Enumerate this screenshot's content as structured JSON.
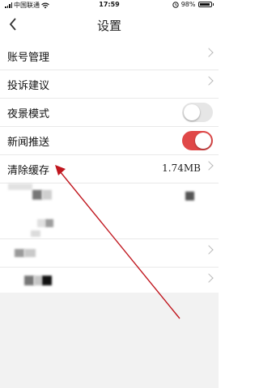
{
  "status_bar": {
    "carrier": "中国联通",
    "time": "17:59",
    "battery": "98%"
  },
  "nav": {
    "title": "设置"
  },
  "settings": {
    "account": "账号管理",
    "feedback": "投诉建议",
    "night_mode": "夜景模式",
    "news_push": "新闻推送",
    "clear_cache": "清除缓存",
    "cache_size": "1.74MB"
  },
  "toggles": {
    "night_mode_on": false,
    "news_push_on": true
  },
  "colors": {
    "toggle_on": "#e04848",
    "toggle_off": "#e6e6e6",
    "annotation_arrow": "#c0161e"
  },
  "icons": {
    "back": "chevron-left-icon",
    "row_arrow": "chevron-right-icon",
    "wifi": "wifi-icon",
    "signal": "signal-icon",
    "battery": "battery-icon",
    "alarm": "alarm-icon"
  }
}
